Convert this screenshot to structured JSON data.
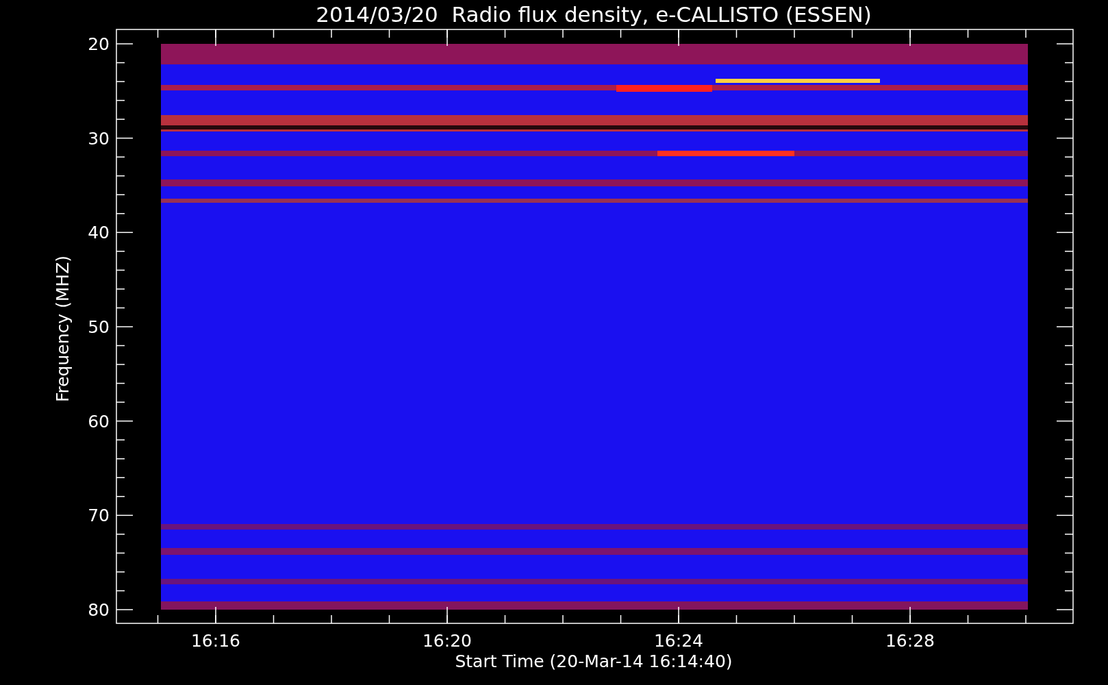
{
  "title": "2014/03/20  Radio flux density, e-CALLISTO (ESSEN)",
  "y_axis": {
    "label": "Frequency (MHZ)",
    "ticks": [
      "20",
      "30",
      "40",
      "50",
      "60",
      "70",
      "80"
    ]
  },
  "x_axis": {
    "label": "Start Time (20-Mar-14 16:14:40)",
    "ticks": [
      "16:16",
      "16:20",
      "16:24",
      "16:28"
    ]
  }
}
